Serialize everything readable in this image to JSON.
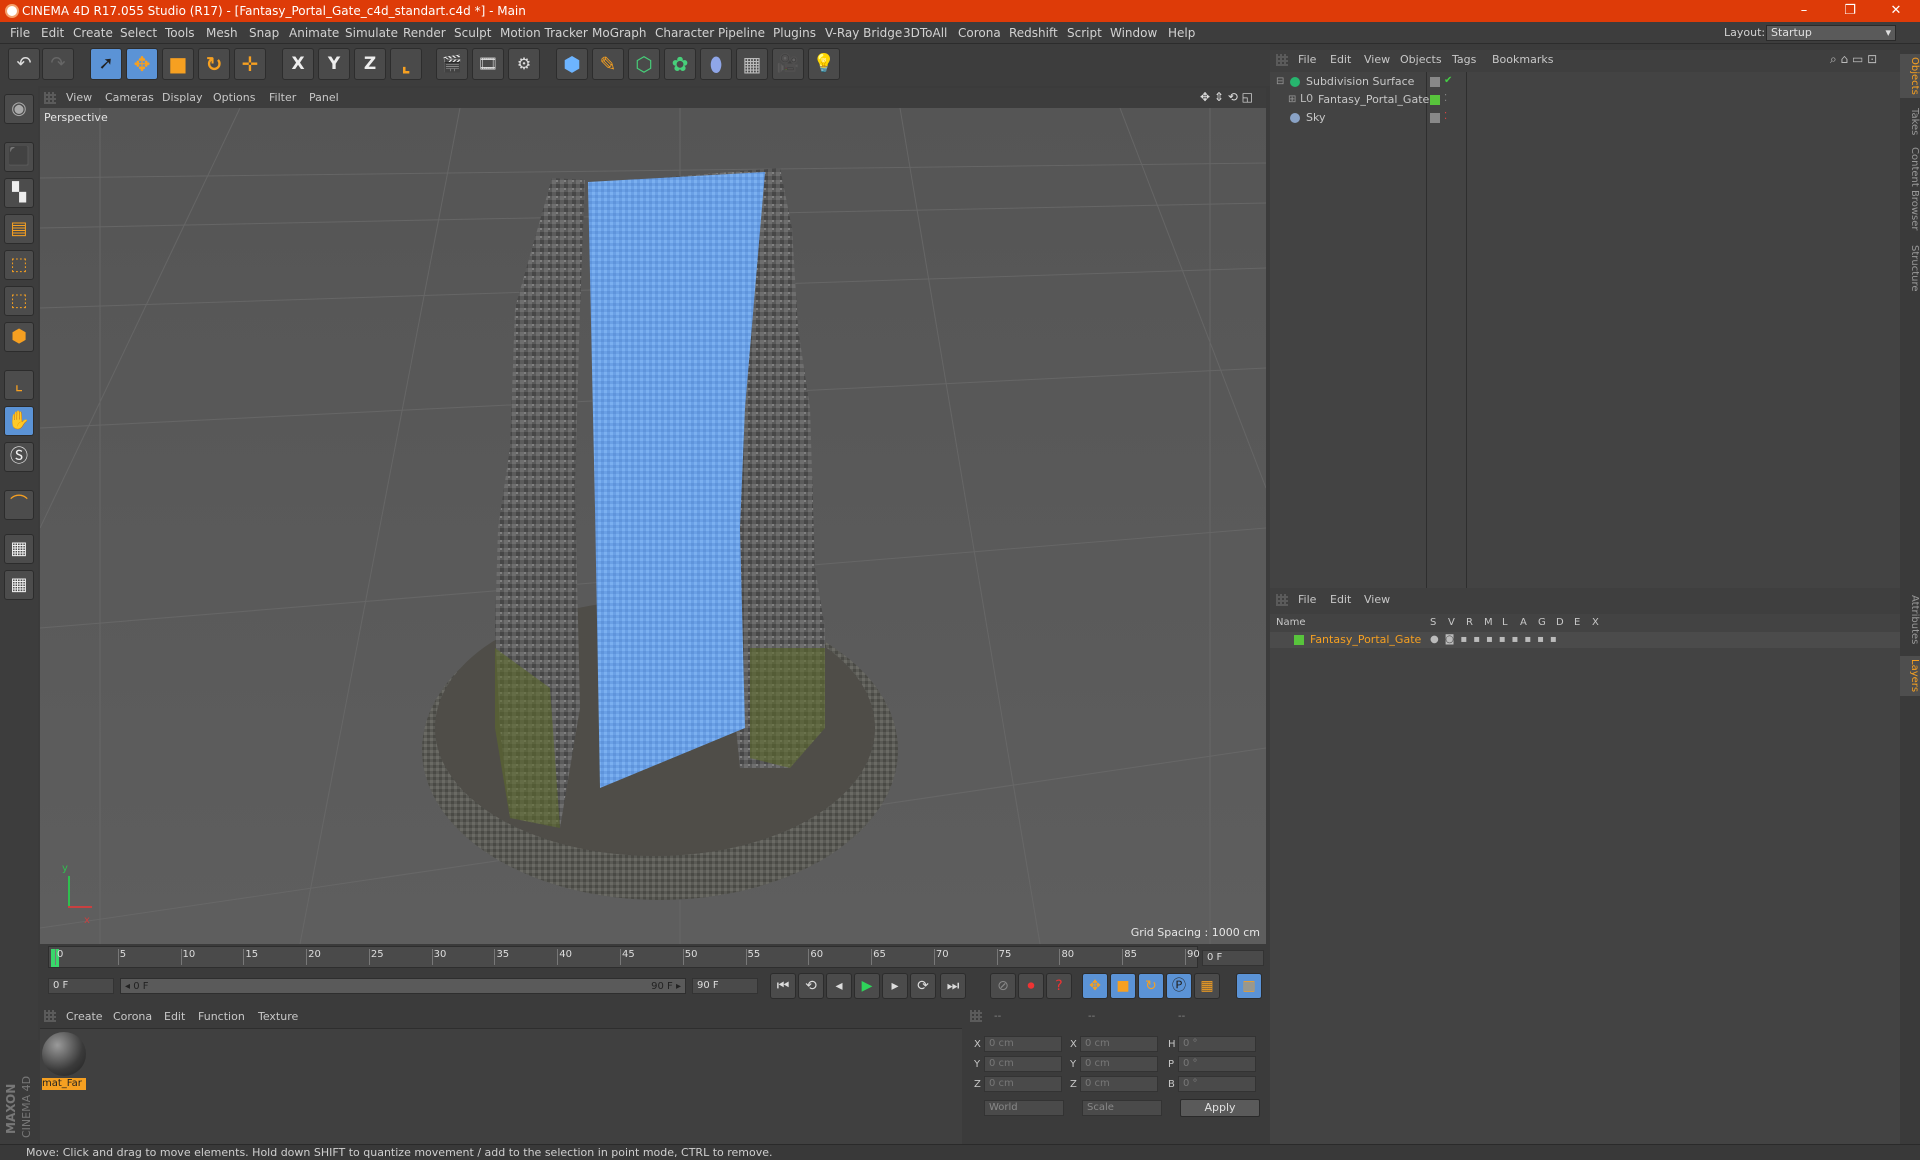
{
  "window": {
    "title": "CINEMA 4D R17.055 Studio (R17) - [Fantasy_Portal_Gate_c4d_standart.c4d *] - Main",
    "minimize": "–",
    "maximize": "❐",
    "close": "✕"
  },
  "menubar": {
    "items": [
      "File",
      "Edit",
      "Create",
      "Select",
      "Tools",
      "Mesh",
      "Snap",
      "Animate",
      "Simulate",
      "Render",
      "Sculpt",
      "Motion Tracker",
      "MoGraph",
      "Character",
      "Pipeline",
      "Plugins",
      "V-Ray Bridge",
      "3DToAll",
      "Corona",
      "Redshift",
      "Script",
      "Window",
      "Help"
    ],
    "layout_label": "Layout:",
    "layout_value": "Startup"
  },
  "toolbar": {
    "axis_x": "X",
    "axis_y": "Y",
    "axis_z": "Z"
  },
  "viewport": {
    "menu": [
      "View",
      "Cameras",
      "Display",
      "Options",
      "Filter",
      "Panel"
    ],
    "name": "Perspective",
    "grid_spacing": "Grid Spacing : 1000 cm",
    "axis_y": "y",
    "axis_x": "x"
  },
  "timeline": {
    "ticks": [
      "0",
      "5",
      "10",
      "15",
      "20",
      "25",
      "30",
      "35",
      "40",
      "45",
      "50",
      "55",
      "60",
      "65",
      "70",
      "75",
      "80",
      "85",
      "90"
    ],
    "current_frame": "0 F",
    "start_frame": "0 F",
    "range_start": "◂ 0 F",
    "range_end": "90 F ▸",
    "end_frame": "90 F"
  },
  "material_panel": {
    "menu": [
      "Create",
      "Corona",
      "Edit",
      "Function",
      "Texture"
    ],
    "material_name": "mat_Far"
  },
  "coordinates": {
    "headers": [
      "--",
      "--",
      "--"
    ],
    "rows": [
      {
        "a": "X",
        "av": "0 cm",
        "b": "X",
        "bv": "0 cm",
        "c": "H",
        "cv": "0 °"
      },
      {
        "a": "Y",
        "av": "0 cm",
        "b": "Y",
        "bv": "0 cm",
        "c": "P",
        "cv": "0 °"
      },
      {
        "a": "Z",
        "av": "0 cm",
        "b": "Z",
        "bv": "0 cm",
        "c": "B",
        "cv": "0 °"
      }
    ],
    "world": "World",
    "scale": "Scale",
    "apply": "Apply"
  },
  "object_manager": {
    "menu": [
      "File",
      "Edit",
      "View",
      "Objects",
      "Tags",
      "Bookmarks"
    ],
    "objects": [
      {
        "name": "Subdivision Surface",
        "color": "#27b56e"
      },
      {
        "name": "Fantasy_Portal_Gate",
        "color": "#bbbbbb"
      },
      {
        "name": "Sky",
        "color": "#8aa3c6"
      }
    ]
  },
  "layer_manager": {
    "menu": [
      "File",
      "Edit",
      "View"
    ],
    "name_header": "Name",
    "columns": [
      "S",
      "V",
      "R",
      "M",
      "L",
      "A",
      "G",
      "D",
      "E",
      "X"
    ],
    "layer_name": "Fantasy_Portal_Gate",
    "layer_color": "#f6a021"
  },
  "right_tabs": [
    "Objects",
    "Takes",
    "Content Browser",
    "Structure",
    "Attributes",
    "Layers"
  ],
  "status": "Move: Click and drag to move elements. Hold down SHIFT to quantize movement / add to the selection in point mode, CTRL to remove.",
  "brand": {
    "maxon": "MAXON",
    "c4d": "CINEMA 4D"
  },
  "colors": {
    "titlebar": "#de3b08",
    "accent": "#f6a021",
    "portal": "#6aa0e6"
  }
}
